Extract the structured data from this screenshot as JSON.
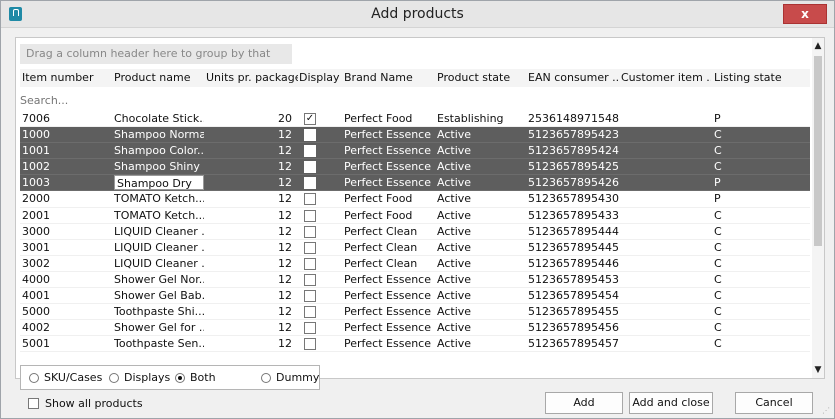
{
  "window": {
    "title": "Add products",
    "close_label": "x"
  },
  "grid": {
    "group_hint": "Drag a column header here to group by that column.",
    "search_placeholder": "Search...",
    "columns": [
      "Item number",
      "Product name",
      "Units pr. package",
      "Display",
      "Brand Name",
      "Product state",
      "EAN consumer ...",
      "Customer item ...",
      "Listing state"
    ],
    "rows": [
      {
        "item": "7006",
        "name": "Chocolate Stick...",
        "units": "20",
        "display": true,
        "brand": "Perfect Food",
        "state": "Establishing",
        "ean": "2536148971548",
        "listing": "P",
        "selected": false
      },
      {
        "item": "1000",
        "name": "Shampoo Normal",
        "units": "12",
        "display": false,
        "brand": "Perfect Essence",
        "state": "Active",
        "ean": "5123657895423",
        "listing": "C",
        "selected": true
      },
      {
        "item": "1001",
        "name": "Shampoo Color...",
        "units": "12",
        "display": false,
        "brand": "Perfect Essence",
        "state": "Active",
        "ean": "5123657895424",
        "listing": "C",
        "selected": true
      },
      {
        "item": "1002",
        "name": "Shampoo Shiny",
        "units": "12",
        "display": false,
        "brand": "Perfect Essence",
        "state": "Active",
        "ean": "5123657895425",
        "listing": "C",
        "selected": true
      },
      {
        "item": "1003",
        "name": "Shampoo Dry",
        "units": "12",
        "display": false,
        "brand": "Perfect Essence",
        "state": "Active",
        "ean": "5123657895426",
        "listing": "P",
        "selected": true,
        "editing": true
      },
      {
        "item": "2000",
        "name": "TOMATO Ketch...",
        "units": "12",
        "display": false,
        "brand": "Perfect Food",
        "state": "Active",
        "ean": "5123657895430",
        "listing": "P",
        "selected": false
      },
      {
        "item": "2001",
        "name": "TOMATO Ketch...",
        "units": "12",
        "display": false,
        "brand": "Perfect Food",
        "state": "Active",
        "ean": "5123657895433",
        "listing": "C",
        "selected": false
      },
      {
        "item": "3000",
        "name": "LIQUID Cleaner ...",
        "units": "12",
        "display": false,
        "brand": "Perfect Clean",
        "state": "Active",
        "ean": "5123657895444",
        "listing": "C",
        "selected": false
      },
      {
        "item": "3001",
        "name": "LIQUID Cleaner ...",
        "units": "12",
        "display": false,
        "brand": "Perfect Clean",
        "state": "Active",
        "ean": "5123657895445",
        "listing": "C",
        "selected": false
      },
      {
        "item": "3002",
        "name": "LIQUID Cleaner ...",
        "units": "12",
        "display": false,
        "brand": "Perfect Clean",
        "state": "Active",
        "ean": "5123657895446",
        "listing": "C",
        "selected": false
      },
      {
        "item": "4000",
        "name": "Shower Gel Nor...",
        "units": "12",
        "display": false,
        "brand": "Perfect Essence",
        "state": "Active",
        "ean": "5123657895453",
        "listing": "C",
        "selected": false
      },
      {
        "item": "4001",
        "name": "Shower Gel Bab...",
        "units": "12",
        "display": false,
        "brand": "Perfect Essence",
        "state": "Active",
        "ean": "5123657895454",
        "listing": "C",
        "selected": false
      },
      {
        "item": "5000",
        "name": "Toothpaste Shi...",
        "units": "12",
        "display": false,
        "brand": "Perfect Essence",
        "state": "Active",
        "ean": "5123657895455",
        "listing": "C",
        "selected": false
      },
      {
        "item": "4002",
        "name": "Shower Gel for ...",
        "units": "12",
        "display": false,
        "brand": "Perfect Essence",
        "state": "Active",
        "ean": "5123657895456",
        "listing": "C",
        "selected": false
      },
      {
        "item": "5001",
        "name": "Toothpaste Sen...",
        "units": "12",
        "display": false,
        "brand": "Perfect Essence",
        "state": "Active",
        "ean": "5123657895457",
        "listing": "C",
        "selected": false
      }
    ]
  },
  "options": {
    "radios": [
      {
        "label": "SKU/Cases",
        "checked": false
      },
      {
        "label": "Displays",
        "checked": false
      },
      {
        "label": "Both",
        "checked": true
      },
      {
        "label": "Dummy",
        "checked": false
      }
    ],
    "show_all_label": "Show all products"
  },
  "buttons": {
    "add": "Add",
    "add_close": "Add and close",
    "cancel": "Cancel"
  },
  "colors": {
    "selected_row": "#5e5e5e",
    "close_button": "#c84b4b",
    "accent": "#1f8aa6"
  },
  "icons": {
    "app": "app-icon",
    "scroll_up": "scroll-up-icon",
    "scroll_down": "scroll-down-icon"
  }
}
